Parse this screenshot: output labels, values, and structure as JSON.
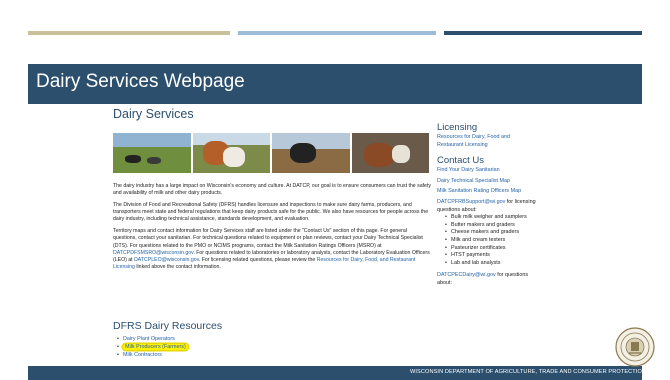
{
  "slide": {
    "title": "Dairy Services Webpage",
    "footer": "WISCONSIN DEPARTMENT OF AGRICULTURE, TRADE AND CONSUMER PROTECTION",
    "colors": {
      "accent": "#2b4f6d",
      "tan": "#c9c19a",
      "light_blue": "#9cbcd8",
      "link": "#2563a8",
      "highlight": "#fff200"
    }
  },
  "page": {
    "heading": "Dairy Services",
    "paragraphs": {
      "p1": "The dairy industry has a large impact on Wisconsin's economy and culture. At DATCP, our goal is to ensure consumers can trust the safety and availability of milk and other dairy products.",
      "p2": "The Division of Food and Recreational Safety (DFRS) handles licensure and inspections to make sure dairy farms, producers, and transporters meet state and federal regulations that keep dairy products safe for the public. We also have resources for people across the dairy industry, including technical assistance, standards development, and evaluation.",
      "p3a": "Territory maps and contact information for Dairy Services staff are listed under the \"Contact Us\" section of this page. For general questions, contact your sanitarian. For technical questions related to equipment or plan reviews, contact your Dairy Technical Specialist (DTS). For questions related to the PMO or NCIMS programs, contact the Milk Sanitation Ratings Officers (MSRO) at",
      "p3_email1": "DATCPDFSMSRO@wisconsin.gov",
      "p3b": ". For questions related to laboratories or laboratory analysts, contact the Laboratory Evaluation Officers (LEO) at",
      "p3_email2": "DATCPLEO@wisconsin.gov",
      "p3c": ". For licensing related questions, please review the",
      "p3_link": "Resources for Dairy, Food, and Restaurant Licensing",
      "p3d": "linked above the contact information."
    },
    "resources_heading": "DFRS Dairy Resources",
    "resources": [
      "Dairy Plant Operators",
      "Milk Producers (Farmers)",
      "Milk Contractors"
    ]
  },
  "sidebar": {
    "licensing_heading": "Licensing",
    "licensing_link": "Resources for Dairy, Food and Restaurant Licensing",
    "contact_heading": "Contact Us",
    "contact_links": [
      "Find Your Dairy Sanitarian",
      "Dairy Technical Specialist Map",
      "Milk Sanitation Rating Officers Map"
    ],
    "support_email": "DATCPFRBSupport@wi.gov",
    "support_text": "for licensing questions about:",
    "topics": [
      "Bulk milk weigher and samplers",
      "Butter makers and graders",
      "Cheese makers and graders",
      "Milk and cream testers",
      "Pasteurizer certificates",
      "HTST payments",
      "Lab and lab analysts"
    ],
    "dairy_email": "DATCPECDairy@wi.gov",
    "dairy_text": "for questions about:"
  }
}
